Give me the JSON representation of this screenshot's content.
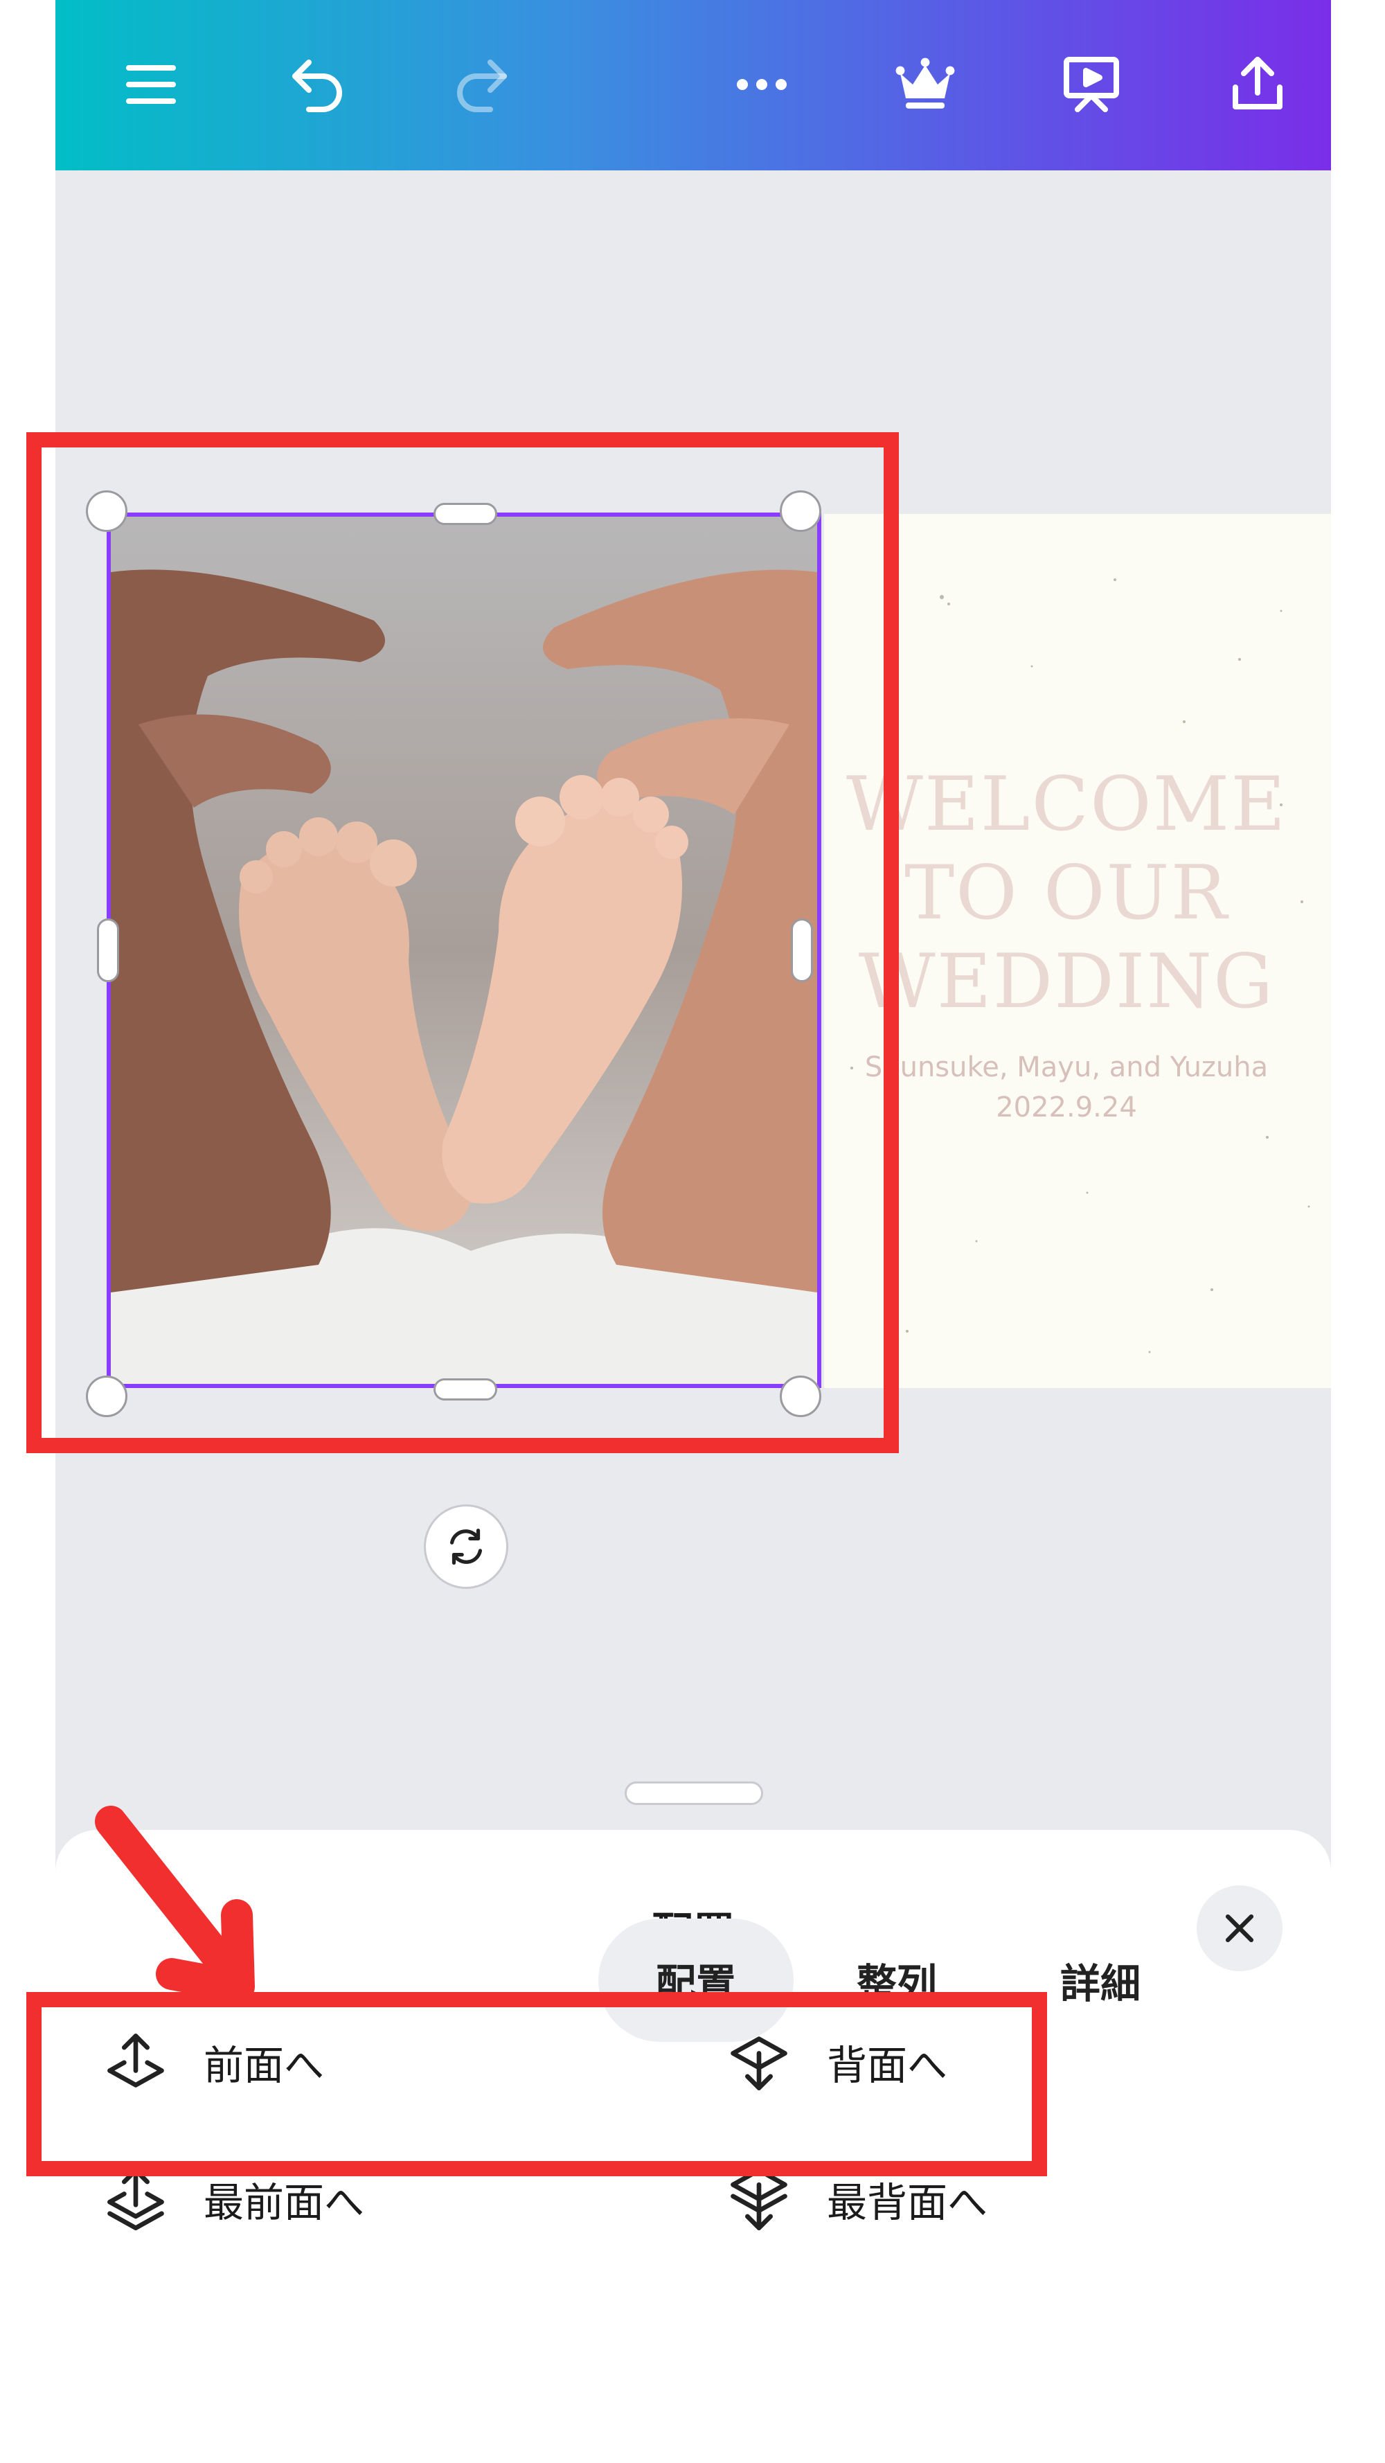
{
  "toolbar": {
    "icons": [
      "menu-icon",
      "undo-icon",
      "redo-icon",
      "more-icon",
      "crown-icon",
      "present-icon",
      "share-icon"
    ]
  },
  "design": {
    "welcome_lines": [
      "WELCOME",
      "TO OUR",
      "WEDDING"
    ],
    "names": "Shunsuke, Mayu, and Yuzuha",
    "date": "2022.9.24",
    "photo_desc": "baby feet held by parents' hands"
  },
  "sheet": {
    "title": "配置",
    "options": {
      "forward": "前面へ",
      "backward": "背面へ",
      "to_front": "最前面へ",
      "to_back": "最背面へ"
    },
    "tabs": [
      "配置",
      "整列",
      "詳細"
    ],
    "active_tab": "配置"
  },
  "colors": {
    "accent": "#8b3dff",
    "annotation": "#f22f2f"
  }
}
